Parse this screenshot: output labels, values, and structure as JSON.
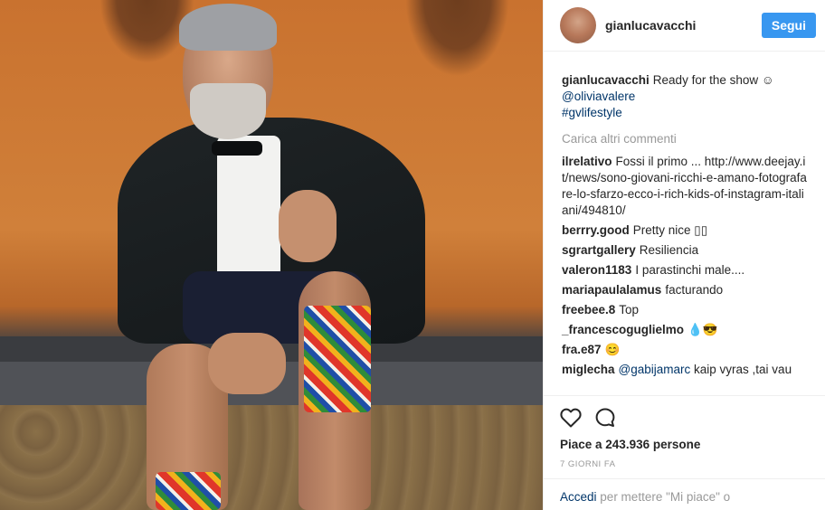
{
  "header": {
    "username": "gianlucavacchi",
    "follow_label": "Segui"
  },
  "caption": {
    "user": "gianlucavacchi",
    "text": "Ready for the show ☺",
    "mention": "@oliviavalere",
    "hashtag": "#gvlifestyle"
  },
  "load_more_label": "Carica altri commenti",
  "comments": [
    {
      "user": "ilrelativo",
      "text": "Fossi il primo ... http://www.deejay.it/news/sono-giovani-ricchi-e-amano-fotografare-lo-sfarzo-ecco-i-rich-kids-of-instagram-italiani/494810/"
    },
    {
      "user": "berrry.good",
      "text": "Pretty nice ▯▯"
    },
    {
      "user": "sgrartgallery",
      "text": "Resiliencia"
    },
    {
      "user": "valeron1183",
      "text": "I parastinchi male...."
    },
    {
      "user": "mariapaulalamus",
      "text": "facturando"
    },
    {
      "user": "freebee.8",
      "text": "Top"
    },
    {
      "user": "_francescoguglielmo",
      "text": "💧😎"
    },
    {
      "user": "fra.e87",
      "text": "😊"
    },
    {
      "user": "miglecha",
      "mention": "@gabijamarc",
      "text": "kaip vyras ,tai vau"
    }
  ],
  "likes": "Piace a 243.936 persone",
  "time_ago": "7 GIORNI FA",
  "login": {
    "link": "Accedi",
    "text": "per mettere \"Mi piace\" o"
  },
  "icons": {
    "like": "heart-icon",
    "comment": "comment-bubble-icon"
  }
}
